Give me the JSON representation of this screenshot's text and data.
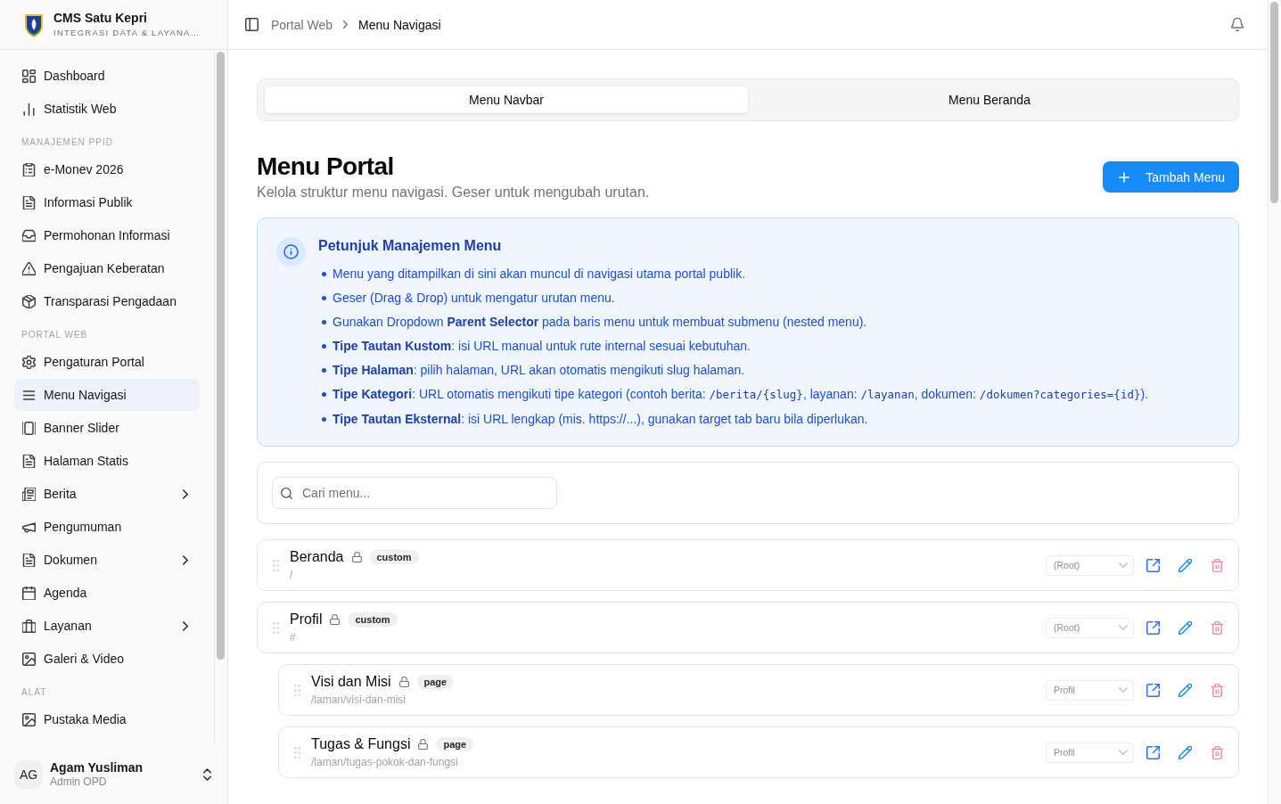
{
  "sidebar": {
    "brand": {
      "title": "CMS Satu Kepri",
      "subtitle": "INTEGRASI DATA & LAYANA…"
    },
    "sections": [
      {
        "items": [
          {
            "label": "Dashboard",
            "selected": false,
            "expandable": false
          },
          {
            "label": "Statistik Web",
            "selected": false,
            "expandable": false
          }
        ]
      },
      {
        "heading": "MANAJEMEN PPID",
        "items": [
          {
            "label": "e-Monev 2026",
            "selected": false,
            "expandable": false
          },
          {
            "label": "Informasi Publik",
            "selected": false,
            "expandable": false
          },
          {
            "label": "Permohonan Informasi",
            "selected": false,
            "expandable": false
          },
          {
            "label": "Pengajuan Keberatan",
            "selected": false,
            "expandable": false
          },
          {
            "label": "Transparasi Pengadaan",
            "selected": false,
            "expandable": false
          }
        ]
      },
      {
        "heading": "PORTAL WEB",
        "items": [
          {
            "label": "Pengaturan Portal",
            "selected": false,
            "expandable": false
          },
          {
            "label": "Menu Navigasi",
            "selected": true,
            "expandable": false
          },
          {
            "label": "Banner Slider",
            "selected": false,
            "expandable": false
          },
          {
            "label": "Halaman Statis",
            "selected": false,
            "expandable": false
          },
          {
            "label": "Berita",
            "selected": false,
            "expandable": true
          },
          {
            "label": "Pengumuman",
            "selected": false,
            "expandable": false
          },
          {
            "label": "Dokumen",
            "selected": false,
            "expandable": true
          },
          {
            "label": "Agenda",
            "selected": false,
            "expandable": false
          },
          {
            "label": "Layanan",
            "selected": false,
            "expandable": true
          },
          {
            "label": "Galeri & Video",
            "selected": false,
            "expandable": false
          }
        ]
      },
      {
        "heading": "ALAT",
        "items": [
          {
            "label": "Pustaka Media",
            "selected": false,
            "expandable": false
          }
        ]
      }
    ],
    "user": {
      "initials": "AG",
      "name": "Agam Yusliman",
      "role": "Admin OPD"
    }
  },
  "breadcrumb": [
    {
      "label": "Portal Web",
      "current": false
    },
    {
      "label": "Menu Navigasi",
      "current": true
    }
  ],
  "tabs": [
    {
      "label": "Menu Navbar",
      "selected": true
    },
    {
      "label": "Menu Beranda",
      "selected": false
    }
  ],
  "page_header": {
    "title": "Menu Portal",
    "subtitle": "Kelola struktur menu navigasi. Geser untuk mengubah urutan.",
    "action": "Tambah Menu"
  },
  "guide": {
    "title": "Petunjuk Manajemen Menu",
    "items": [
      {
        "parts": [
          {
            "kind": "text",
            "text": "Menu yang ditampilkan di sini akan muncul di navigasi utama portal publik."
          }
        ]
      },
      {
        "parts": [
          {
            "kind": "text",
            "text": "Geser (Drag & Drop) untuk mengatur urutan menu."
          }
        ]
      },
      {
        "parts": [
          {
            "kind": "text",
            "text": "Gunakan Dropdown "
          },
          {
            "kind": "strong",
            "text": "Parent Selector"
          },
          {
            "kind": "text",
            "text": " pada baris menu untuk membuat submenu (nested menu)."
          }
        ]
      },
      {
        "parts": [
          {
            "kind": "strong",
            "text": "Tipe Tautan Kustom"
          },
          {
            "kind": "text",
            "text": ": isi URL manual untuk rute internal sesuai kebutuhan."
          }
        ]
      },
      {
        "parts": [
          {
            "kind": "strong",
            "text": "Tipe Halaman"
          },
          {
            "kind": "text",
            "text": ": pilih halaman, URL akan otomatis mengikuti slug halaman."
          }
        ]
      },
      {
        "parts": [
          {
            "kind": "strong",
            "text": "Tipe Kategori"
          },
          {
            "kind": "text",
            "text": ": URL otomatis mengikuti tipe kategori (contoh berita: "
          },
          {
            "kind": "code",
            "text": "/berita/{slug}"
          },
          {
            "kind": "text",
            "text": ", layanan: "
          },
          {
            "kind": "code",
            "text": "/layanan"
          },
          {
            "kind": "text",
            "text": ", dokumen: "
          },
          {
            "kind": "code",
            "text": "/dokumen?categories={id}"
          },
          {
            "kind": "text",
            "text": ")."
          }
        ]
      },
      {
        "parts": [
          {
            "kind": "strong",
            "text": "Tipe Tautan Eksternal"
          },
          {
            "kind": "text",
            "text": ": isi URL lengkap (mis. https://...), gunakan target tab baru bila diperlukan."
          }
        ]
      }
    ]
  },
  "search": {
    "placeholder": "Cari menu..."
  },
  "menu_items": [
    {
      "title": "Beranda",
      "locked": true,
      "badge": "custom",
      "url": "/",
      "parent": "(Root)"
    },
    {
      "title": "Profil",
      "locked": true,
      "badge": "custom",
      "url": "#",
      "parent": "(Root)",
      "children": [
        {
          "title": "Visi dan Misi",
          "locked": true,
          "badge": "page",
          "url": "/laman/visi-dan-misi",
          "parent": "Profil"
        },
        {
          "title": "Tugas & Fungsi",
          "locked": true,
          "badge": "page",
          "url": "/laman/tugas-pokok-dan-fungsi",
          "parent": "Profil"
        }
      ]
    }
  ]
}
